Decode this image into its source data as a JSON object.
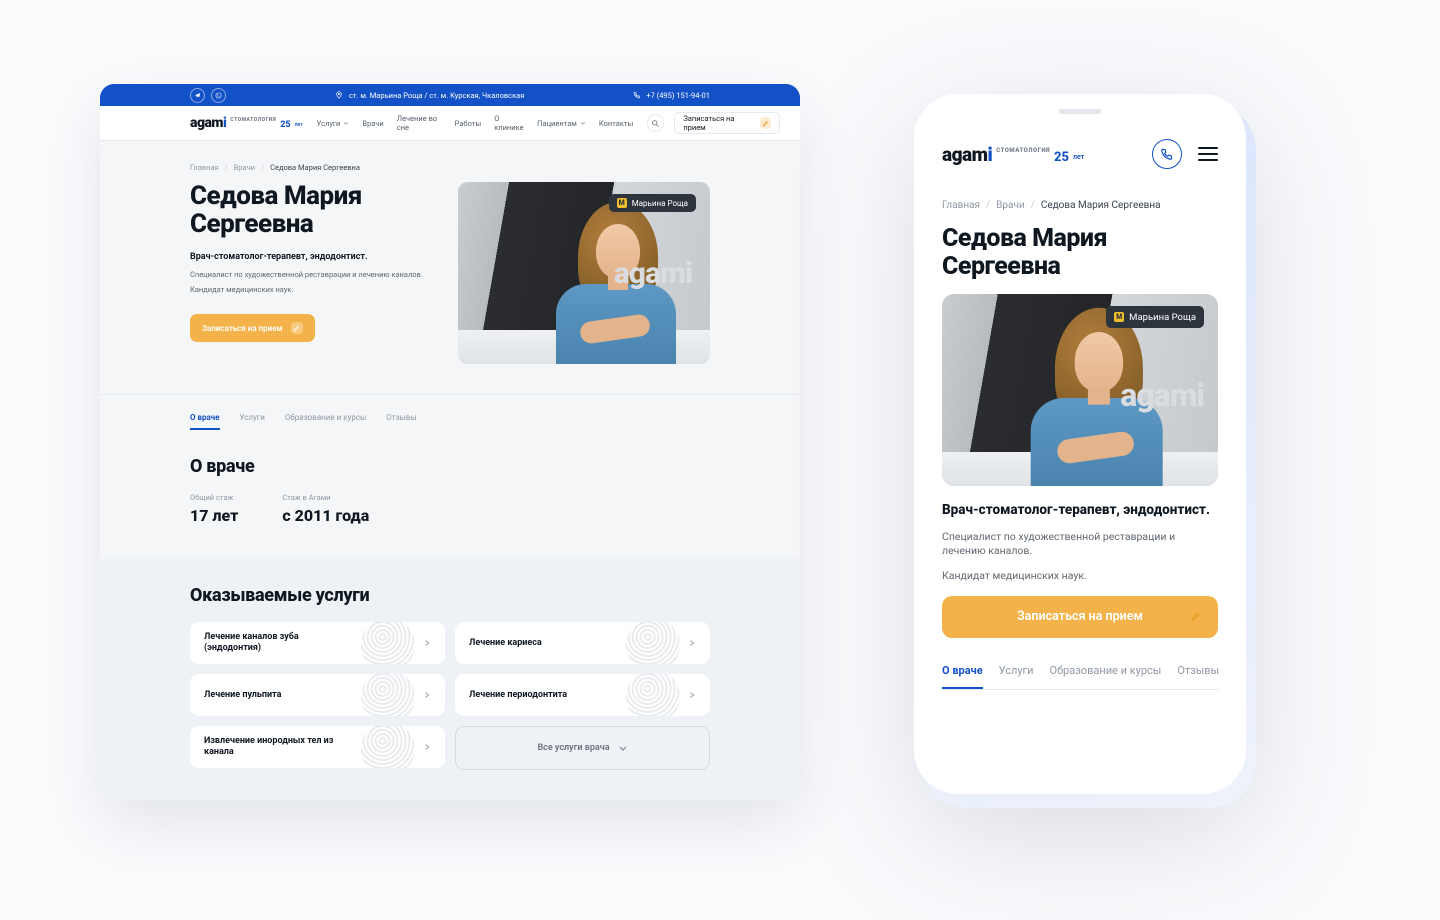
{
  "brand": {
    "name_pre": "agam",
    "name_accent": "i",
    "subtitle": "СТОМАТОЛОГИЯ",
    "years": "25",
    "years_suffix": "лет"
  },
  "topbar": {
    "location_full": "ст. м. Марьина Роща / ст. м. Курская, Чкаловская",
    "phone": "+7 (495) 151-94-01"
  },
  "nav": {
    "items": [
      {
        "label": "Услуги",
        "dropdown": true
      },
      {
        "label": "Врачи",
        "dropdown": false
      },
      {
        "label": "Лечение во сне",
        "dropdown": false
      },
      {
        "label": "Работы",
        "dropdown": false
      },
      {
        "label": "О клинике",
        "dropdown": false
      },
      {
        "label": "Пациентам",
        "dropdown": true
      },
      {
        "label": "Контакты",
        "dropdown": false
      }
    ],
    "signup_label": "Записаться на прием"
  },
  "breadcrumbs": [
    "Главная",
    "Врачи",
    "Седова Мария Сергеевна"
  ],
  "doctor": {
    "name": "Седова Мария Сергеевна",
    "role": "Врач-стоматолог-терапевт, эндодонтист.",
    "desc1": "Специалист по художественной реставрации и лечению каналов.",
    "desc2": "Кандидат медицинских наук.",
    "cta": "Записаться на прием",
    "location_badge": "Марьина Роща"
  },
  "tabs": [
    "О враче",
    "Услуги",
    "Образование и курсы",
    "Отзывы"
  ],
  "about": {
    "heading": "О враче",
    "exp_label": "Общий стаж",
    "exp_value": "17 лет",
    "since_label": "Стаж в Агами",
    "since_value": "с 2011 года"
  },
  "services": {
    "heading": "Оказываемые услуги",
    "items": [
      "Лечение каналов зуба (эндодонтия)",
      "Лечение кариеса",
      "Лечение пульпита",
      "Лечение периодонтита",
      "Извлечение инородных тел из канала"
    ],
    "all_label": "Все услуги врача"
  }
}
